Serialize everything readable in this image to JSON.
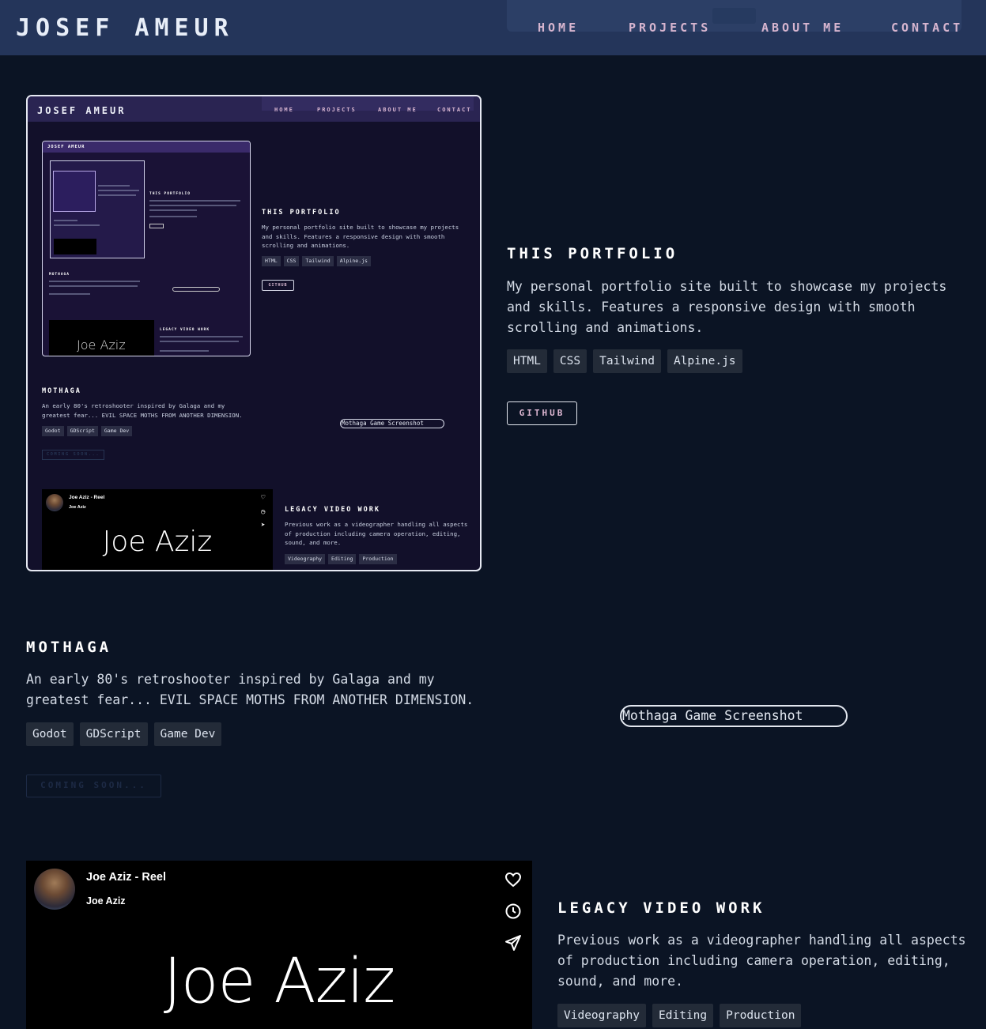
{
  "header": {
    "brand": "JOSEF AMEUR",
    "nav": [
      {
        "label": "HOME"
      },
      {
        "label": "PROJECTS"
      },
      {
        "label": "ABOUT ME"
      },
      {
        "label": "CONTACT"
      }
    ],
    "ghost_button": "ABOUT ME"
  },
  "portfolio": {
    "title": "THIS PORTFOLIO",
    "description": "My personal portfolio site built to showcase my projects and skills. Features a responsive design with smooth scrolling and animations.",
    "tags": [
      "HTML",
      "CSS",
      "Tailwind",
      "Alpine.js"
    ],
    "github_label": "GITHUB"
  },
  "mothaga": {
    "title": "MOTHAGA",
    "description": "An early 80's retroshooter inspired by Galaga and my greatest fear... EVIL SPACE MOTHS FROM ANOTHER DIMENSION.",
    "tags": [
      "Godot",
      "GDScript",
      "Game Dev"
    ],
    "coming_soon_label": "COMING SOON...",
    "image_alt": "Mothaga Game Screenshot"
  },
  "legacy": {
    "title": "LEGACY VIDEO WORK",
    "description": "Previous work as a videographer handling all aspects of production including camera operation, editing, sound, and more.",
    "tags": [
      "Videography",
      "Editing",
      "Production"
    ]
  },
  "video": {
    "title": "Joe Aziz - Reel",
    "author": "Joe Aziz",
    "name_card": "Joe Aziz",
    "icons": [
      "heart-icon",
      "clock-icon",
      "share-icon"
    ]
  }
}
